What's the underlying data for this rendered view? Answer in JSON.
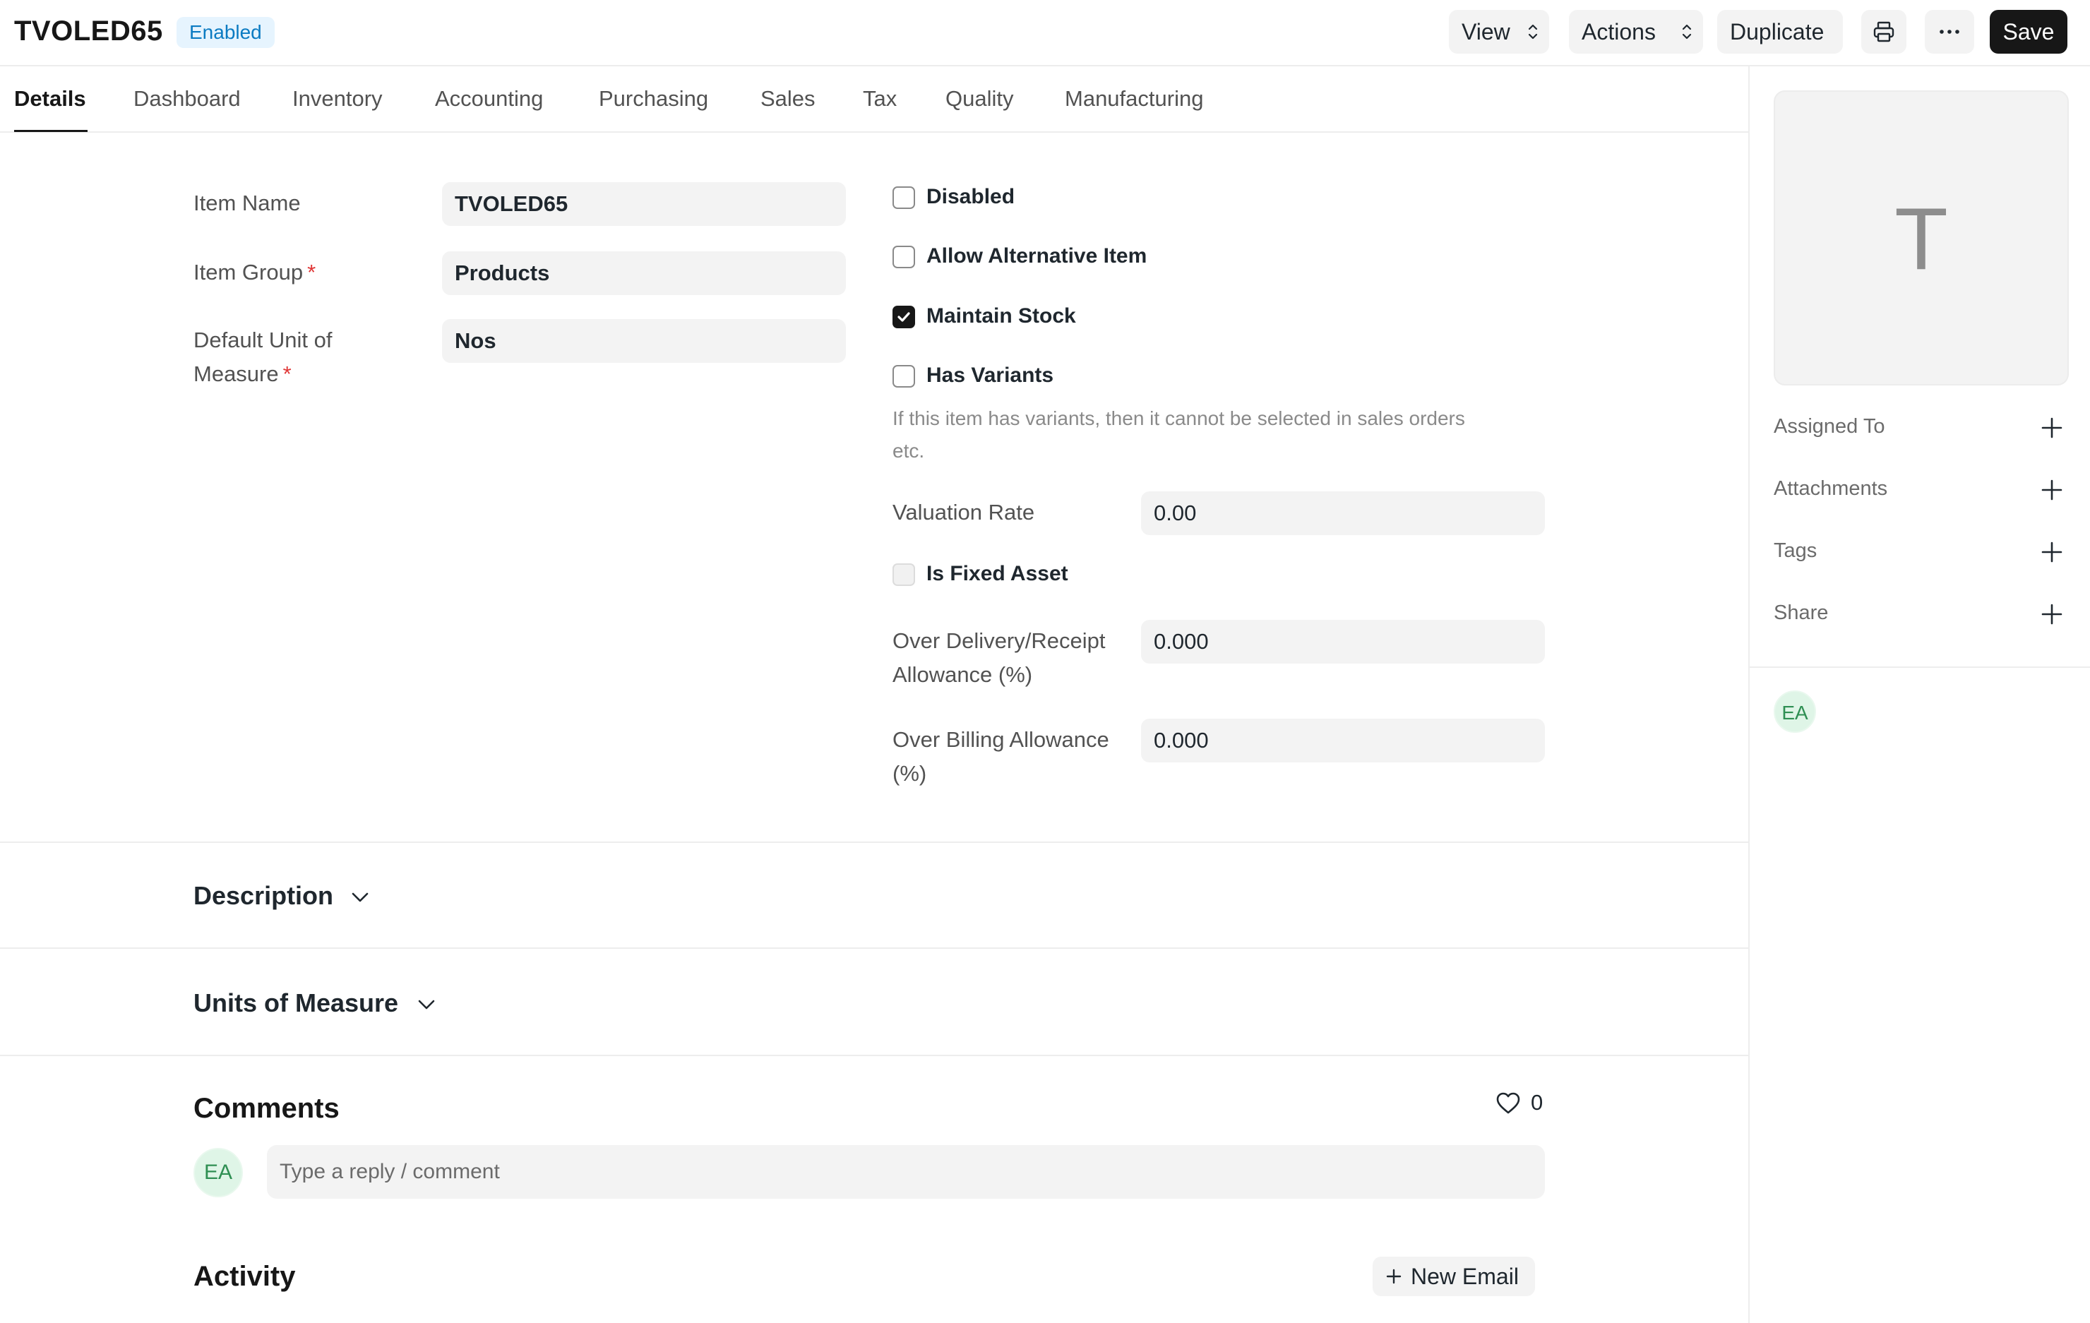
{
  "header": {
    "title": "TVOLED65",
    "status": "Enabled",
    "view_label": "View",
    "actions_label": "Actions",
    "duplicate_label": "Duplicate",
    "save_label": "Save",
    "print_icon": "printer-icon",
    "more_icon": "more-horizontal-icon"
  },
  "tabs": [
    {
      "label": "Details",
      "active": true
    },
    {
      "label": "Dashboard"
    },
    {
      "label": "Inventory"
    },
    {
      "label": "Accounting"
    },
    {
      "label": "Purchasing"
    },
    {
      "label": "Sales"
    },
    {
      "label": "Tax"
    },
    {
      "label": "Quality"
    },
    {
      "label": "Manufacturing"
    }
  ],
  "form": {
    "item_name_label": "Item Name",
    "item_name_value": "TVOLED65",
    "item_group_label": "Item Group",
    "item_group_value": "Products",
    "uom_label_line1": "Default Unit of",
    "uom_label_line2": "Measure",
    "uom_value": "Nos",
    "required_mark": "*",
    "checkboxes": {
      "disabled": {
        "label": "Disabled",
        "checked": false
      },
      "allow_alternative": {
        "label": "Allow Alternative Item",
        "checked": false
      },
      "maintain_stock": {
        "label": "Maintain Stock",
        "checked": true
      },
      "has_variants": {
        "label": "Has Variants",
        "checked": false
      },
      "is_fixed_asset": {
        "label": "Is Fixed Asset",
        "checked": false
      }
    },
    "has_variants_help_line1": "If this item has variants, then it cannot be selected in sales orders",
    "has_variants_help_line2": "etc.",
    "valuation_rate_label": "Valuation Rate",
    "valuation_rate_value": "0.00",
    "over_delivery_label_line1": "Over Delivery/Receipt",
    "over_delivery_label_line2": "Allowance (%)",
    "over_delivery_value": "0.000",
    "over_billing_label_line1": "Over Billing Allowance",
    "over_billing_label_line2": "(%)",
    "over_billing_value": "0.000"
  },
  "sections": {
    "description": "Description",
    "units_of_measure": "Units of Measure"
  },
  "comments": {
    "title": "Comments",
    "like_count": "0",
    "avatar_initials": "EA",
    "placeholder": "Type a reply / comment"
  },
  "activity": {
    "title": "Activity",
    "new_email_label": "New Email"
  },
  "sidebar": {
    "image_letter": "T",
    "items": [
      {
        "label": "Assigned To"
      },
      {
        "label": "Attachments"
      },
      {
        "label": "Tags"
      },
      {
        "label": "Share"
      }
    ],
    "viewer_initials": "EA"
  }
}
